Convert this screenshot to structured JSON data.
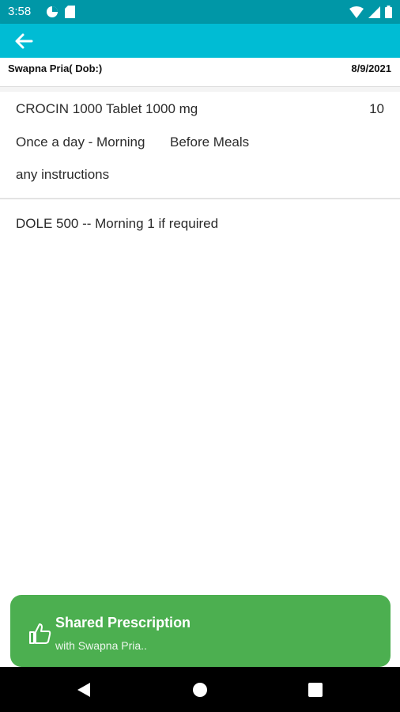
{
  "status_bar": {
    "time": "3:58",
    "left_icons": [
      "data-saver-icon",
      "sim-card-icon"
    ],
    "right_icons": [
      "wifi-icon",
      "cellular-signal-icon",
      "battery-icon"
    ]
  },
  "app_bar": {
    "back_icon": "arrow-back-icon",
    "color": "#00bcd4"
  },
  "patient": {
    "name": "Swapna Pria( Dob:)",
    "date": "8/9/2021"
  },
  "medicine": {
    "name": "CROCIN 1000 Tablet 1000 mg",
    "quantity": "10",
    "frequency": "Once a day - Morning",
    "timing": "Before Meals",
    "instructions": "any instructions"
  },
  "note": "DOLE 500 -- Morning 1 if required",
  "toast": {
    "icon": "thumbs-up-icon",
    "title": "Shared Prescription",
    "subtitle": "with Swapna Pria..",
    "color": "#4caf50"
  },
  "nav_bar": {
    "buttons": [
      "back-triangle-icon",
      "home-circle-icon",
      "recents-square-icon"
    ]
  }
}
